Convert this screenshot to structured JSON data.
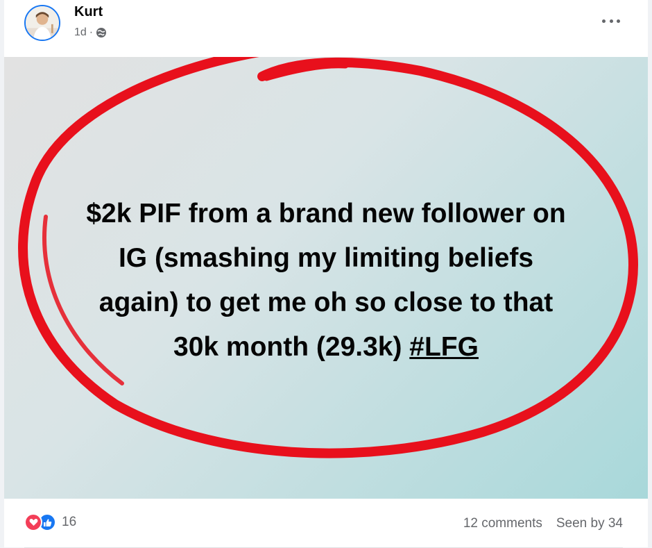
{
  "post": {
    "author": "Kurt",
    "time": "1d",
    "separator": "·",
    "privacy_icon": "globe-icon",
    "more_icon": "more-options-icon",
    "text_lines": [
      "$2k PIF from a brand new follower on",
      "IG (smashing my limiting beliefs",
      "again) to get me oh so close to that",
      "30k month (29.3k) "
    ],
    "hashtag": "#LFG",
    "annotation_color": "#e8101c"
  },
  "footer": {
    "reaction_icons": [
      "love-icon",
      "like-icon"
    ],
    "reaction_count": "16",
    "comments": "12 comments",
    "seen_by": "Seen by 34"
  },
  "colors": {
    "brand_blue": "#1877f2",
    "love_red": "#f33e58",
    "secondary_text": "#65676b"
  }
}
